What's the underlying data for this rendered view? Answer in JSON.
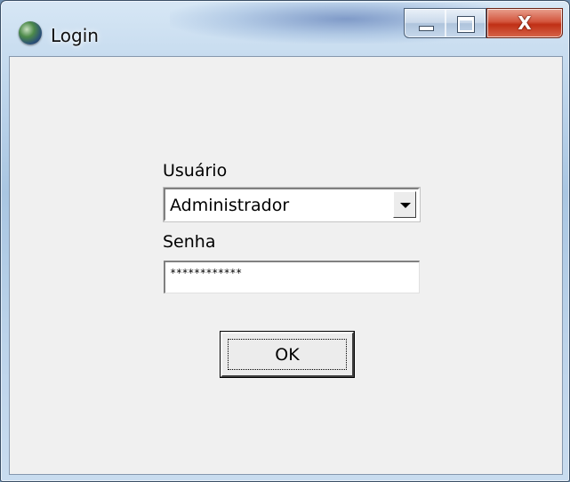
{
  "window": {
    "title": "Login",
    "icon": "globe-icon"
  },
  "caption_buttons": {
    "minimize_icon": "minimize-icon",
    "maximize_icon": "maximize-icon",
    "close_glyph": "X"
  },
  "form": {
    "user_label": "Usuário",
    "user_value": "Administrador",
    "password_label": "Senha",
    "password_value": "************",
    "ok_label": "OK"
  },
  "colors": {
    "client_bg": "#f0f0f0",
    "close_button": "#c02f15",
    "frame_glass": "#bfd6ec"
  }
}
